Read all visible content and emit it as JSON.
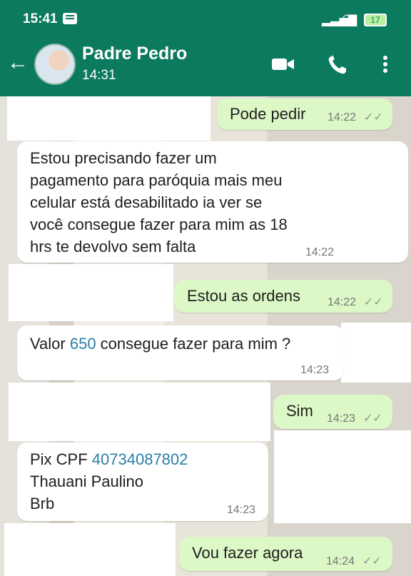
{
  "status_bar": {
    "time": "15:41",
    "battery": "17"
  },
  "header": {
    "contact_name": "Padre Pedro",
    "last_seen": "14:31",
    "back_icon": "arrow-left-icon",
    "video_icon": "video-call-icon",
    "phone_icon": "phone-icon",
    "more_icon": "more-vertical-icon"
  },
  "messages": [
    {
      "direction": "outgoing",
      "text": "Pode pedir",
      "time": "14:22",
      "status": "read"
    },
    {
      "direction": "incoming",
      "lines": [
        "Estou precisando fazer um",
        "pagamento para paróquia mais meu",
        "celular está desabilitado ia ver se",
        "você consegue fazer para mim as 18",
        "hrs te devolvo sem falta"
      ],
      "time": "14:22"
    },
    {
      "direction": "outgoing",
      "text": "Estou as ordens",
      "time": "14:22",
      "status": "read"
    },
    {
      "direction": "incoming",
      "prefix": "Valor ",
      "highlight": "650",
      "suffix": " consegue fazer para mim ?",
      "time": "14:23"
    },
    {
      "direction": "outgoing",
      "text": "Sim",
      "time": "14:23",
      "status": "read"
    },
    {
      "direction": "incoming",
      "line1_prefix": "Pix CPF ",
      "line1_highlight": "40734087802",
      "line2": "Thauani Paulino",
      "line3": "Brb",
      "time": "14:23"
    },
    {
      "direction": "outgoing",
      "text": "Vou fazer agora",
      "time": "14:24",
      "status": "read"
    }
  ],
  "colors": {
    "header": "#0b7a5e",
    "outgoing_bubble": "#dcf8c6",
    "incoming_bubble": "#ffffff",
    "link": "#2b7fa8"
  }
}
